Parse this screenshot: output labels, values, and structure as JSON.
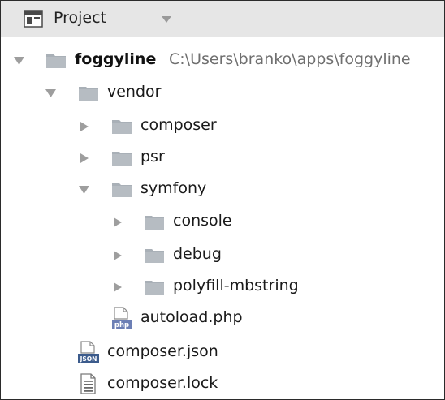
{
  "panel": {
    "title": "Project"
  },
  "tree": {
    "root": {
      "name": "foggyline",
      "path": "C:\\Users\\branko\\apps\\foggyline"
    },
    "vendor": "vendor",
    "composer_dir": "composer",
    "psr": "psr",
    "symfony": "symfony",
    "console": "console",
    "debug": "debug",
    "polyfill": "polyfill-mbstring",
    "autoload": "autoload.php",
    "composer_json": "composer.json",
    "composer_lock": "composer.lock"
  },
  "colors": {
    "header_bg": "#e6e6e6",
    "folder": "#a9b0b7",
    "arrow": "#9e9e9e",
    "path_text": "#6f6f6f"
  },
  "icons": {
    "header": "project-view-icon",
    "dropdown": "chevron-down-icon",
    "expanded": "triangle-down-icon",
    "collapsed": "triangle-right-icon",
    "folder": "folder-icon",
    "php": "php-file-icon",
    "json": "json-file-icon",
    "lock": "text-file-icon"
  }
}
